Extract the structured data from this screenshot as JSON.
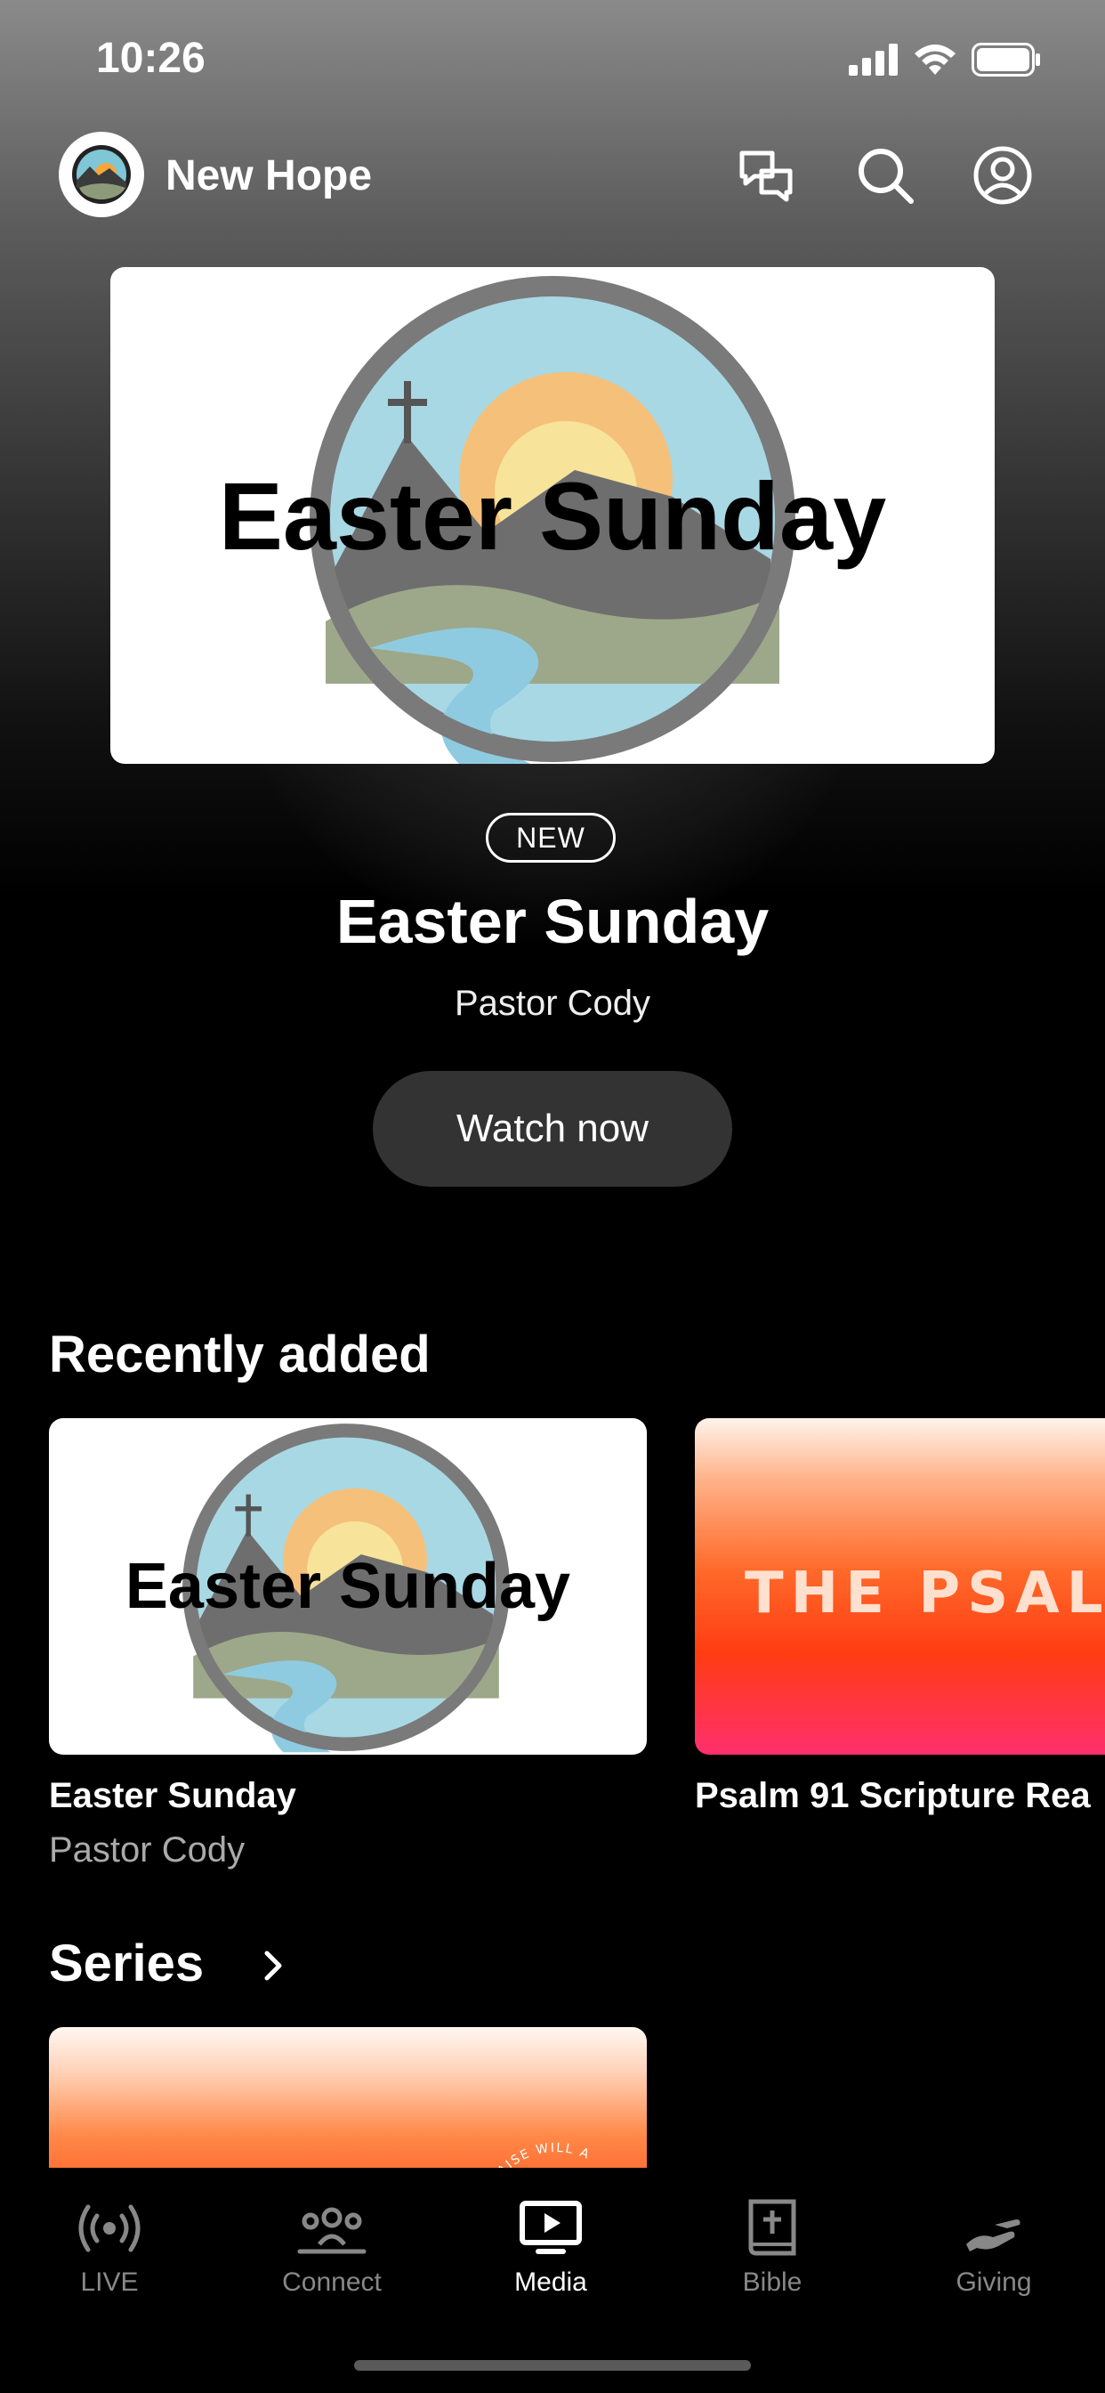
{
  "status_bar": {
    "time": "10:26"
  },
  "header": {
    "title": "New Hope"
  },
  "hero": {
    "artwork_title": "Easter Sunday",
    "badge": "NEW",
    "title": "Easter Sunday",
    "subtitle": "Pastor Cody",
    "button_label": "Watch now"
  },
  "recently_added": {
    "title": "Recently added",
    "items": [
      {
        "artwork_title": "Easter Sunday",
        "title": "Easter Sunday",
        "subtitle": "Pastor Cody"
      },
      {
        "artwork_title": "THE PSALM",
        "title": "Psalm 91 Scripture Rea",
        "subtitle": ""
      }
    ]
  },
  "series": {
    "title": "Series",
    "items": [
      {
        "artwork_text": "HIS PRAISE WILL A"
      }
    ]
  },
  "tabbar": {
    "items": [
      {
        "label": "LIVE",
        "icon": "live-broadcast-icon",
        "active": false
      },
      {
        "label": "Connect",
        "icon": "people-group-icon",
        "active": false
      },
      {
        "label": "Media",
        "icon": "play-screen-icon",
        "active": true
      },
      {
        "label": "Bible",
        "icon": "bible-cross-icon",
        "active": false
      },
      {
        "label": "Giving",
        "icon": "giving-hand-icon",
        "active": false
      }
    ]
  },
  "colors": {
    "background": "#000000",
    "button": "#333333",
    "inactive_tab": "#888888",
    "psalm_red": "#ff3c12"
  }
}
